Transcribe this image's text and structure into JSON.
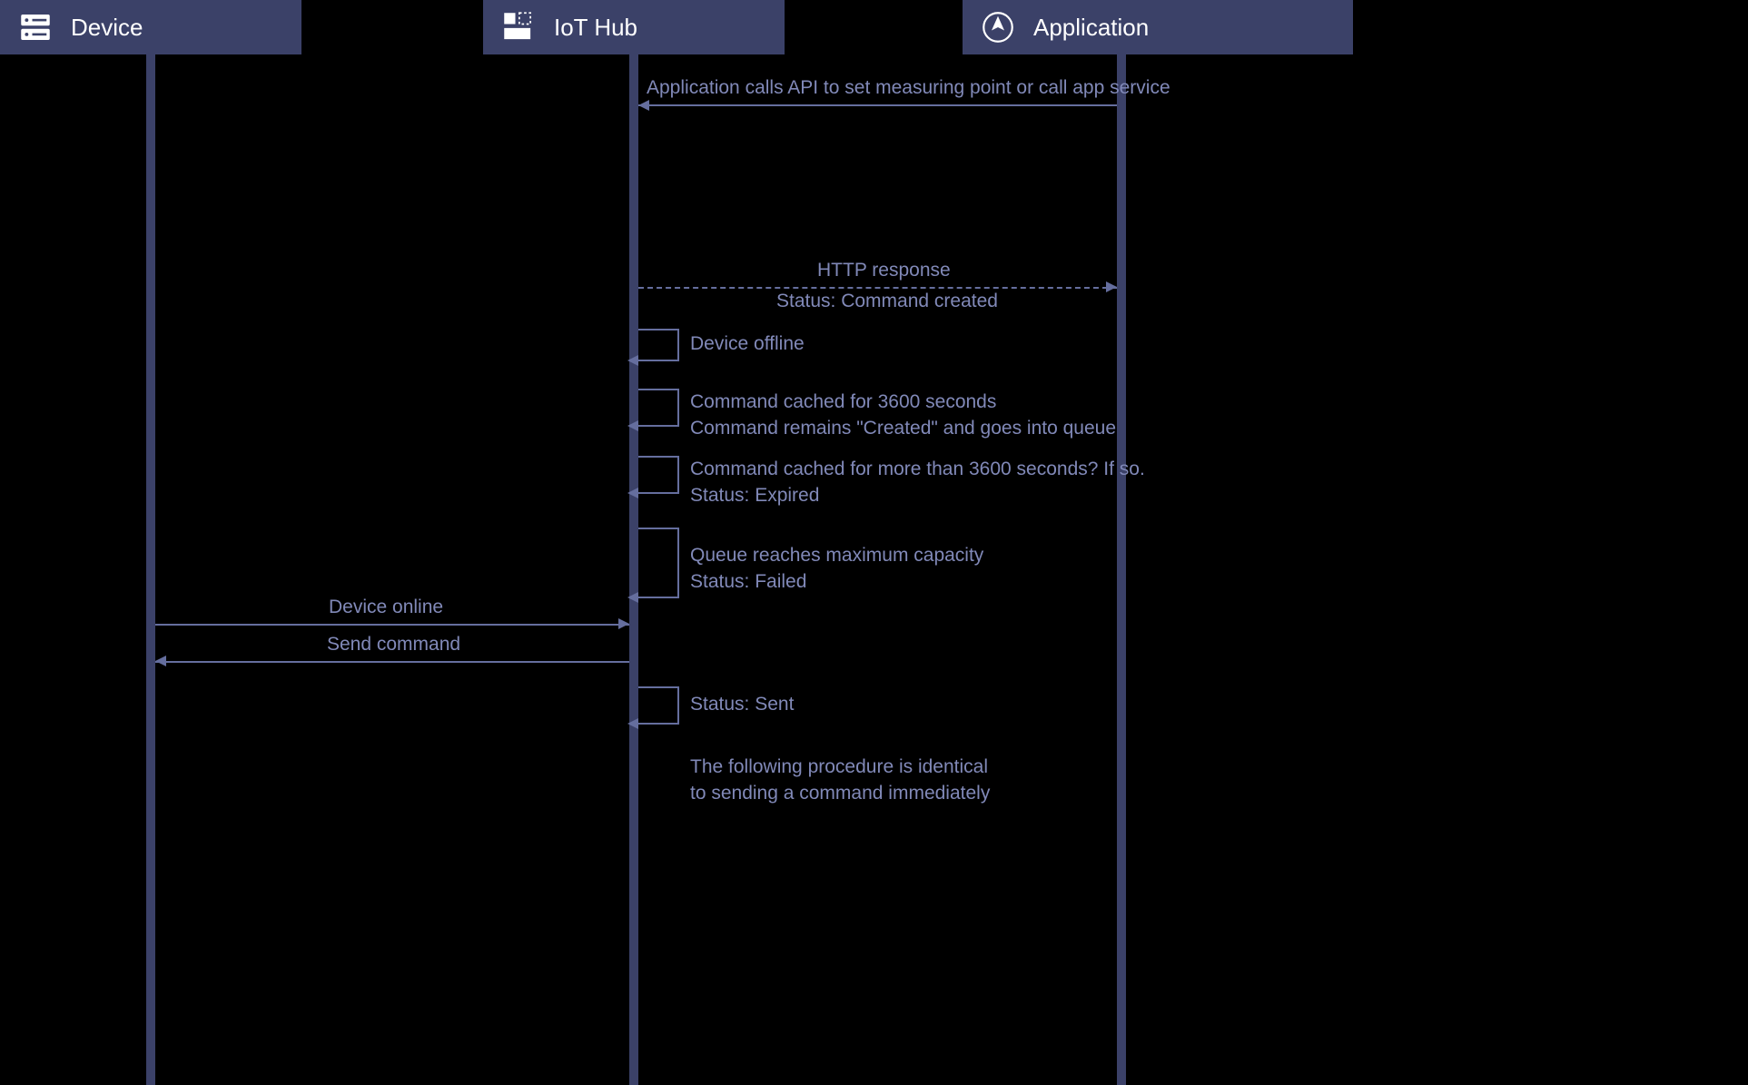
{
  "actors": {
    "device": "Device",
    "iot_hub": "IoT Hub",
    "application": "Application"
  },
  "messages": {
    "m1": "Application calls API to set measuring point or call app service",
    "m2_top": "HTTP response",
    "m2_bottom": "Status: Command created",
    "self1": "Device offline",
    "self2_l1": "Command cached for 3600 seconds",
    "self2_l2": "Command remains \"Created\" and goes into queue",
    "self3_l1": "Command cached for more than 3600 seconds? If so.",
    "self3_l2": "Status: Expired",
    "self4_l1": "Queue reaches maximum capacity",
    "self4_l2": "Status: Failed",
    "m3": "Device online",
    "m4": "Send command",
    "self5": "Status: Sent",
    "note_l1": "The following procedure is identical",
    "note_l2": "to sending a command immediately"
  },
  "colors": {
    "bar_bg": "#3b4168",
    "text_dim": "#8189b8",
    "arrow": "#656e9e"
  }
}
